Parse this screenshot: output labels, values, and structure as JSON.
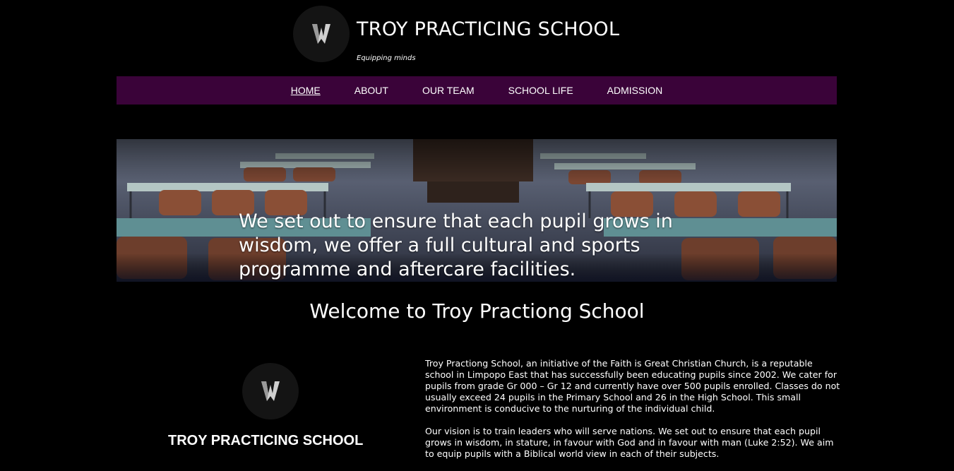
{
  "header": {
    "logo_icon": "troy-shield-icon",
    "title": "TROY PRACTICING SCHOOL",
    "tagline": "Equipping minds"
  },
  "nav": {
    "items": [
      {
        "label": "HOME",
        "active": true
      },
      {
        "label": "ABOUT",
        "active": false
      },
      {
        "label": "OUR TEAM",
        "active": false
      },
      {
        "label": "SCHOOL LIFE",
        "active": false
      },
      {
        "label": "ADMISSION",
        "active": false
      }
    ],
    "bg_color": "#3a0339"
  },
  "hero": {
    "image": "classroom-desks-photo",
    "text": "We set out to ensure that each pupil grows in wisdom, we offer a full cultural and sports programme and aftercare facilities."
  },
  "welcome": {
    "heading": "Welcome to Troy Practiong School"
  },
  "about": {
    "logo_icon": "troy-shield-icon",
    "school_name": "TROY PRACTICING SCHOOL",
    "paragraphs": [
      "Troy Practiong School, an initiative of the Faith is Great Christian Church, is a reputable school in Limpopo East that has successfully been educating pupils since 2002. We cater for pupils from grade Gr 000 – Gr 12 and currently have over 500 pupils enrolled. Classes do not usually exceed 24 pupils in the Primary School and 26 in the High School. This small environment is conducive to the nurturing of the individual child.",
      "Our vision is to train leaders who will serve nations. We set out to ensure that each pupil grows in wisdom, in stature, in favour with God and in favour with man (Luke 2:52). We aim to equip pupils with a Biblical world view in each of their subjects."
    ]
  }
}
